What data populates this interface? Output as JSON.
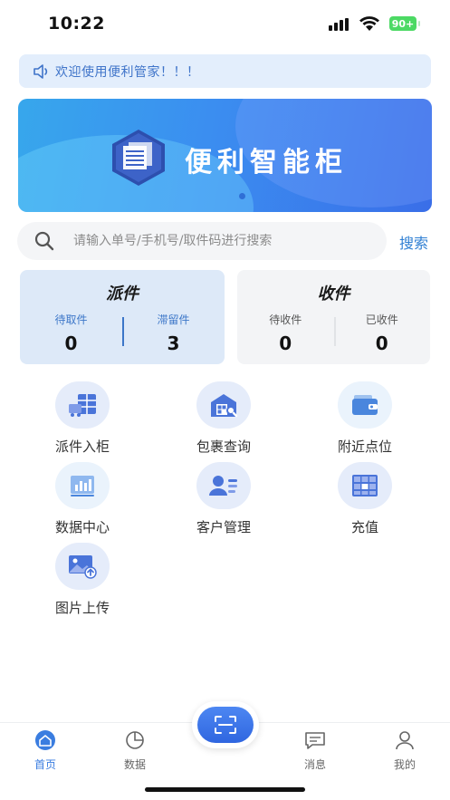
{
  "status_bar": {
    "time": "10:22",
    "battery": "90+"
  },
  "notice": {
    "icon": "speaker-icon",
    "text": "欢迎使用便利管家！！！"
  },
  "banner": {
    "title": "便利智能柜",
    "logo": "cabinet-logo-icon",
    "active_slide": 1
  },
  "search": {
    "placeholder": "请输入单号/手机号/取件码进行搜索",
    "value": "",
    "button_label": "搜索",
    "icon": "search-icon"
  },
  "dispatch_panel": {
    "title": "派件",
    "stats": [
      {
        "label": "待取件",
        "value": "0"
      },
      {
        "label": "滞留件",
        "value": "3"
      }
    ]
  },
  "receive_panel": {
    "title": "收件",
    "stats": [
      {
        "label": "待收件",
        "value": "0"
      },
      {
        "label": "已收件",
        "value": "0"
      }
    ]
  },
  "grid": [
    {
      "label": "派件入柜",
      "icon": "dispatch-cabinet-icon"
    },
    {
      "label": "包裹查询",
      "icon": "package-search-icon"
    },
    {
      "label": "附近点位",
      "icon": "wallet-icon"
    },
    {
      "label": "数据中心",
      "icon": "data-chart-icon"
    },
    {
      "label": "客户管理",
      "icon": "customer-card-icon"
    },
    {
      "label": "充值",
      "icon": "cabinet-grid-icon"
    },
    {
      "label": "图片上传",
      "icon": "image-upload-icon"
    }
  ],
  "tabbar": {
    "items": [
      {
        "label": "首页",
        "icon": "home-icon",
        "active": true
      },
      {
        "label": "数据",
        "icon": "pie-chart-icon",
        "active": false
      },
      {
        "label": "消息",
        "icon": "message-icon",
        "active": false
      },
      {
        "label": "我的",
        "icon": "user-icon",
        "active": false
      }
    ],
    "center_icon": "scan-icon"
  },
  "colors": {
    "accent": "#3a7de0",
    "link": "#2f7fd3",
    "icon_bg": "#e5ecfa",
    "dispatch_bg": "#dde9f8"
  }
}
